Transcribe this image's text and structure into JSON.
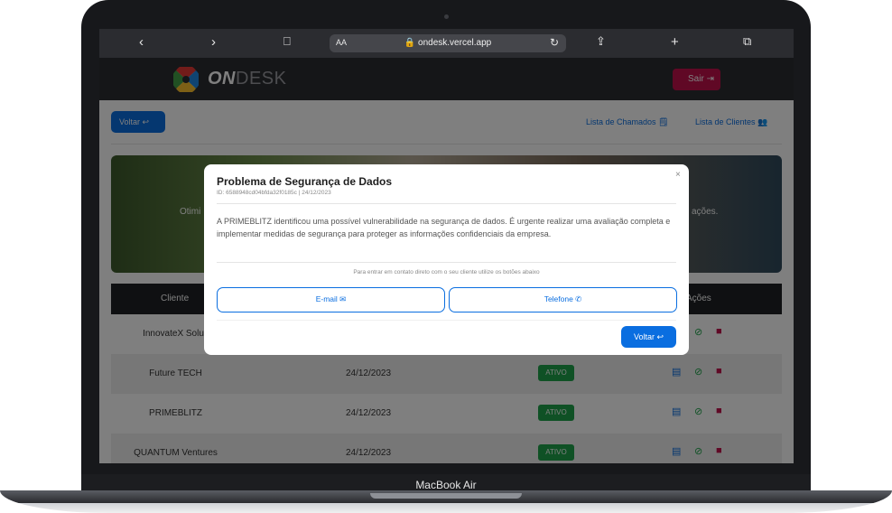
{
  "browser": {
    "back": "‹",
    "forward": "›",
    "reader": "⎕",
    "aa": "AA",
    "url": "🔒 ondesk.vercel.app",
    "reload": "↻",
    "share": "⇪",
    "new_tab": "+",
    "tabs": "⧉"
  },
  "header": {
    "brand_bold": "ON",
    "brand_rest": "DESK",
    "logout_label": "Sair ⇥"
  },
  "nav": {
    "back_label": "Voltar ↩",
    "tickets_label": "Lista de Chamados 🗒",
    "clients_label": "Lista de Clientes 👥"
  },
  "hero": {
    "text_left": "Otimi",
    "text_right": "ações."
  },
  "table": {
    "headers": {
      "client": "Cliente",
      "actions": "Ações"
    },
    "rows": [
      {
        "name": "InnovateX Soluti",
        "date": "",
        "status": ""
      },
      {
        "name": "Future TECH",
        "date": "24/12/2023",
        "status": "ATIVO"
      },
      {
        "name": "PRIMEBLITZ",
        "date": "24/12/2023",
        "status": "ATIVO"
      },
      {
        "name": "QUANTUM Ventures",
        "date": "24/12/2023",
        "status": "ATIVO"
      }
    ]
  },
  "modal": {
    "title": "Problema de Segurança de Dados",
    "meta": "ID: 6588948cd04bfda32f0185c | 24/12/2023",
    "close": "×",
    "body": "A PRIMEBLITZ identificou uma possível vulnerabilidade na segurança de dados. É urgente realizar uma avaliação completa e implementar medidas de segurança para proteger as informações confidenciais da empresa.",
    "hint": "Para entrar em contato direto com o seu cliente utilize os botões abaixo",
    "email_label": "E-mail ✉",
    "phone_label": "Telefone ✆",
    "back_label": "Voltar ↩"
  },
  "device": {
    "label": "MacBook Air"
  },
  "colors": {
    "primary": "#0a6ee0",
    "danger": "#c0114b",
    "success": "#1ea34a",
    "dark": "#2b2c30"
  }
}
